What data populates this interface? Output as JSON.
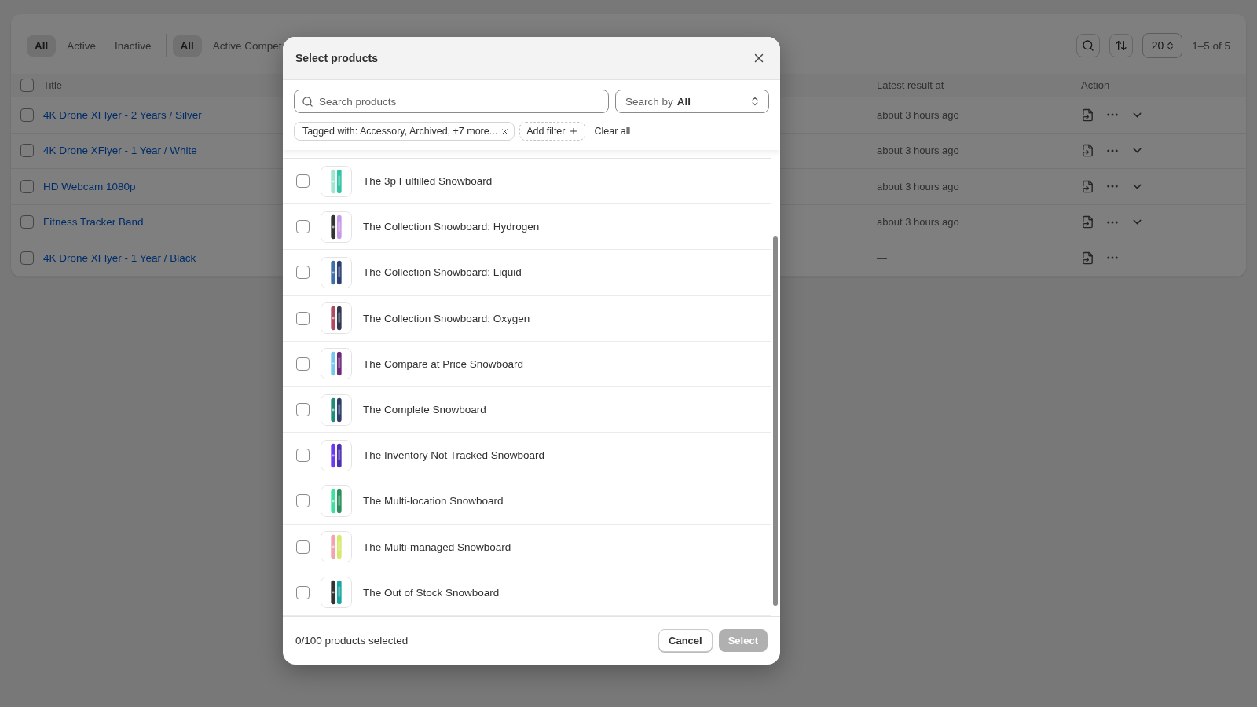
{
  "page": {
    "status_tabs": [
      {
        "label": "All",
        "selected": true
      },
      {
        "label": "Active",
        "selected": false
      },
      {
        "label": "Inactive",
        "selected": false
      }
    ],
    "competitor_tabs": [
      {
        "label": "All",
        "selected": true
      },
      {
        "label": "Active Compet",
        "selected": false
      }
    ],
    "page_size": "20",
    "range": "1–5 of 5",
    "table": {
      "select_all_checked": false,
      "columns": [
        "Title",
        "Latest result at",
        "Action"
      ],
      "rows": [
        {
          "title": "4K Drone XFlyer - 2 Years / Silver",
          "checked": false,
          "latest": "about 3 hours ago",
          "expandable": true
        },
        {
          "title": "4K Drone XFlyer - 1 Year / White",
          "checked": false,
          "latest": "about 3 hours ago",
          "expandable": true
        },
        {
          "title": "HD Webcam 1080p",
          "checked": false,
          "latest": "about 3 hours ago",
          "expandable": true
        },
        {
          "title": "Fitness Tracker Band",
          "checked": false,
          "latest": "about 3 hours ago",
          "expandable": true
        },
        {
          "title": "4K Drone XFlyer - 1 Year / Black",
          "checked": false,
          "latest": "—",
          "expandable": false
        }
      ]
    }
  },
  "dialog": {
    "title": "Select products",
    "search": {
      "placeholder": "Search products"
    },
    "search_by": {
      "label": "Search by",
      "value": "All"
    },
    "filters": [
      {
        "label": "Tagged with: Accessory, Archived, +7 more..."
      }
    ],
    "add_filter": "Add filter",
    "clear_all": "Clear all",
    "products": [
      {
        "name": "The 3p Fulfilled Snowboard",
        "checked": false
      },
      {
        "name": "The Collection Snowboard: Hydrogen",
        "checked": false
      },
      {
        "name": "The Collection Snowboard: Liquid",
        "checked": false
      },
      {
        "name": "The Collection Snowboard: Oxygen",
        "checked": false
      },
      {
        "name": "The Compare at Price Snowboard",
        "checked": false
      },
      {
        "name": "The Complete Snowboard",
        "checked": false
      },
      {
        "name": "The Inventory Not Tracked Snowboard",
        "checked": false
      },
      {
        "name": "The Multi-location Snowboard",
        "checked": false
      },
      {
        "name": "The Multi-managed Snowboard",
        "checked": false
      },
      {
        "name": "The Out of Stock Snowboard",
        "checked": false
      }
    ],
    "selected_count": "0/100 products selected",
    "buttons": [
      {
        "label": "Cancel",
        "disabled": false,
        "primary": false
      },
      {
        "label": "Select",
        "disabled": true,
        "primary": true
      }
    ]
  }
}
